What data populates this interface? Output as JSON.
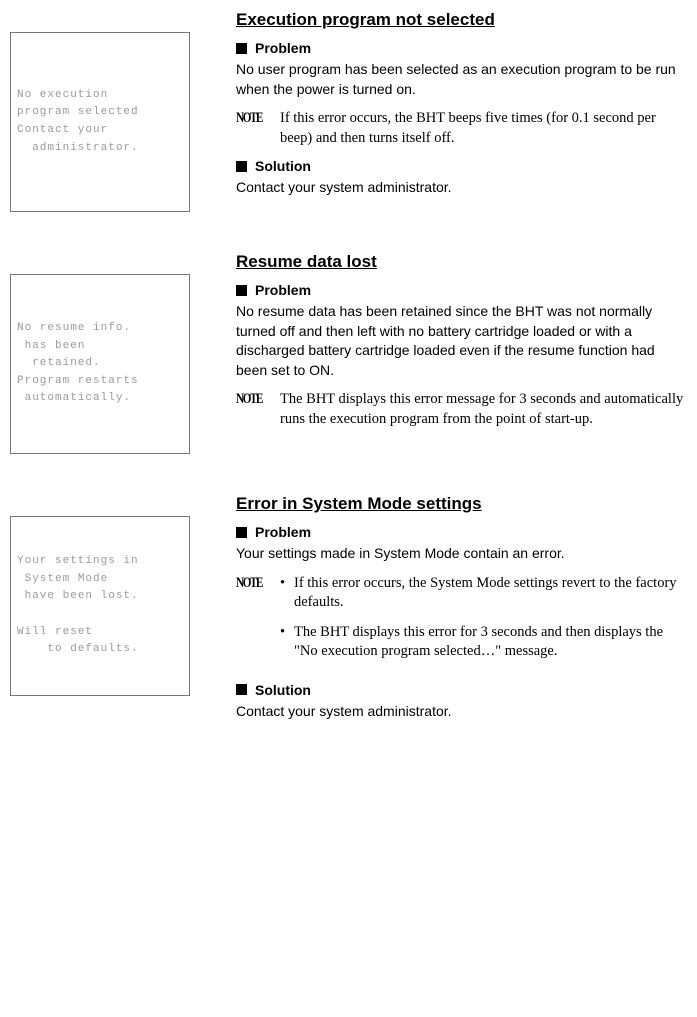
{
  "sections": [
    {
      "screen_text": "No execution\nprogram selected\nContact your\n  administrator.",
      "title": "Execution program not selected",
      "problem_heading": "Problem",
      "problem_text": "No user program has been selected as an execution program to be run when the power is turned on.",
      "note_label": "NOTE",
      "note_text": "If this error occurs, the BHT beeps five times (for 0.1 second per beep) and then turns itself off.",
      "solution_heading": "Solution",
      "solution_text": "Contact your system administrator."
    },
    {
      "screen_text": "No resume info.\n has been\n  retained.\nProgram restarts\n automatically.",
      "title": "Resume data lost",
      "problem_heading": "Problem",
      "problem_text": "No resume data has been retained since the BHT was not normally turned off and then left with no battery cartridge loaded or with a discharged battery cartridge loaded even if the resume function had been set to ON.",
      "note_label": "NOTE",
      "note_text": "The BHT displays this error message for 3 seconds and automatically runs the execution program from the point of start-up."
    },
    {
      "screen_text": "Your settings in\n System Mode\n have been lost.\n\nWill reset\n    to defaults.",
      "title": "Error in System Mode settings",
      "problem_heading": "Problem",
      "problem_text": "Your settings made in System Mode contain an error.",
      "note_label": "NOTE",
      "note_bullets": [
        "If this error occurs, the System Mode settings revert to the factory defaults.",
        "The BHT displays this error for 3 seconds and then displays the \"No execution program selected…\" message."
      ],
      "solution_heading": "Solution",
      "solution_text": "Contact your system administrator."
    }
  ]
}
